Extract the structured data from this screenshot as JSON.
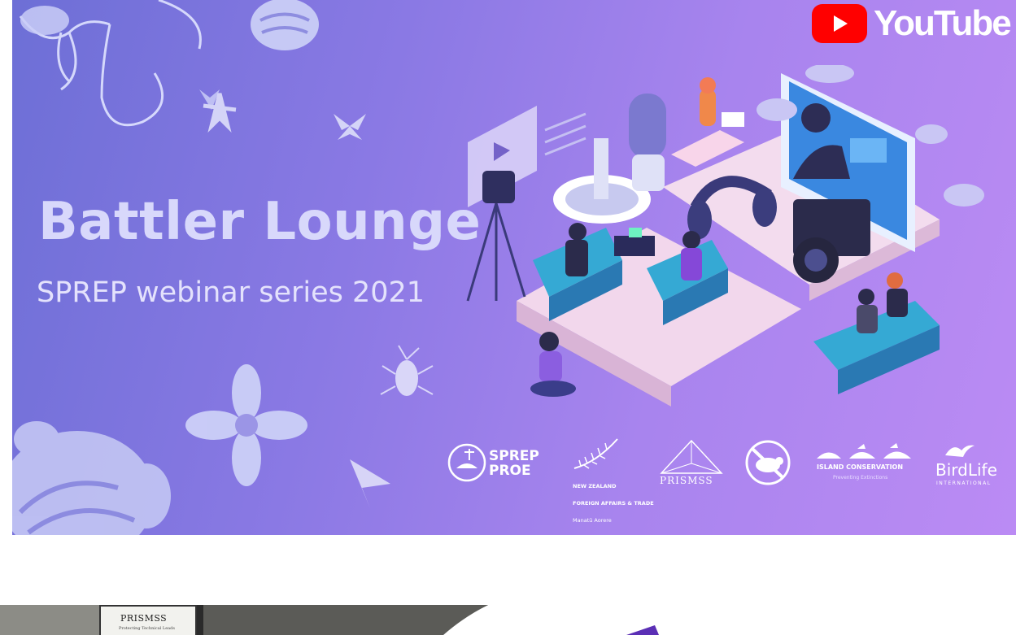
{
  "banner": {
    "title": "Battler Lounge",
    "subtitle": "SPREP webinar series 2021",
    "colors": {
      "gradient_start": "#6d6fd6",
      "gradient_end": "#bb8bf4",
      "title_text": "#d8d8fb"
    }
  },
  "youtube": {
    "label": "YouTube",
    "icon": "play-icon",
    "color": "#ff0000"
  },
  "logos": {
    "sprep": {
      "line1": "SPREP",
      "line2": "PROE"
    },
    "nz": {
      "line1": "NEW ZEALAND",
      "line2": "FOREIGN AFFAIRS & TRADE",
      "line3": "Manatū Aorere"
    },
    "prismss": {
      "label": "PRISMSS"
    },
    "island_conservation": {
      "title": "ISLAND CONSERVATION",
      "tagline": "Preventing Extinctions"
    },
    "birdlife": {
      "name": "BirdLife",
      "sub": "INTERNATIONAL"
    }
  },
  "photo": {
    "sign_title": "PRISMSS",
    "sign_subtitle": "Protecting Technical Leads"
  }
}
